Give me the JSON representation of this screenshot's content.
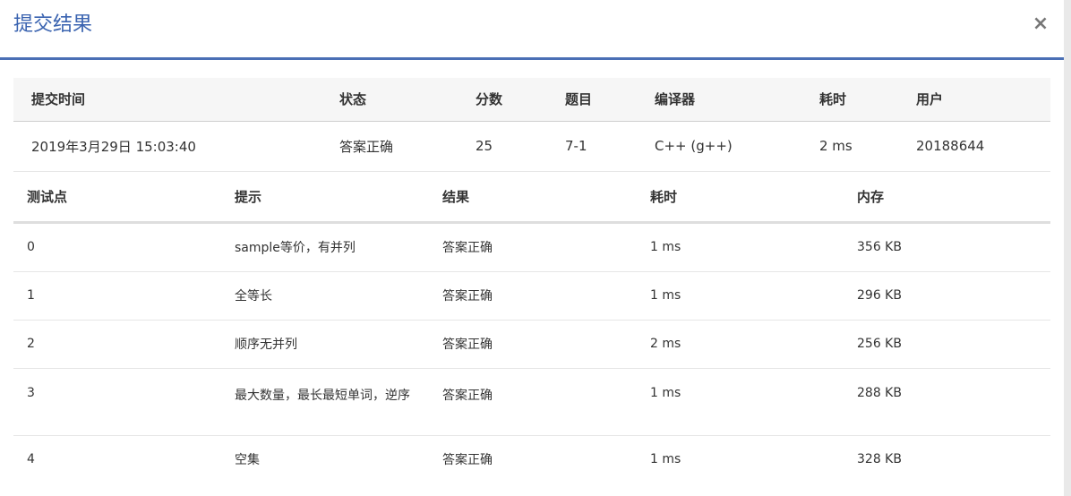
{
  "modal": {
    "title": "提交结果",
    "close_label": "×"
  },
  "summary": {
    "headers": [
      "提交时间",
      "状态",
      "分数",
      "题目",
      "编译器",
      "耗时",
      "用户"
    ],
    "row": {
      "time": "2019年3月29日 15:03:40",
      "status": "答案正确",
      "score": "25",
      "problem": "7-1",
      "compiler": "C++ (g++)",
      "elapsed": "2 ms",
      "user": "20188644"
    }
  },
  "cases": {
    "headers": [
      "测试点",
      "提示",
      "结果",
      "耗时",
      "内存"
    ],
    "rows": [
      {
        "id": "0",
        "hint": "sample等价，有并列",
        "result": "答案正确",
        "time": "1 ms",
        "memory": "356 KB"
      },
      {
        "id": "1",
        "hint": "全等长",
        "result": "答案正确",
        "time": "1 ms",
        "memory": "296 KB"
      },
      {
        "id": "2",
        "hint": "顺序无并列",
        "result": "答案正确",
        "time": "2 ms",
        "memory": "256 KB"
      },
      {
        "id": "3",
        "hint": "最大数量，最长最短单词，逆序",
        "result": "答案正确",
        "time": "1 ms",
        "memory": "288 KB"
      },
      {
        "id": "4",
        "hint": "空集",
        "result": "答案正确",
        "time": "1 ms",
        "memory": "328 KB"
      }
    ]
  },
  "colors": {
    "accent": "#3a63b0",
    "success_text": "#e0463a",
    "link": "#2c5aa0"
  }
}
